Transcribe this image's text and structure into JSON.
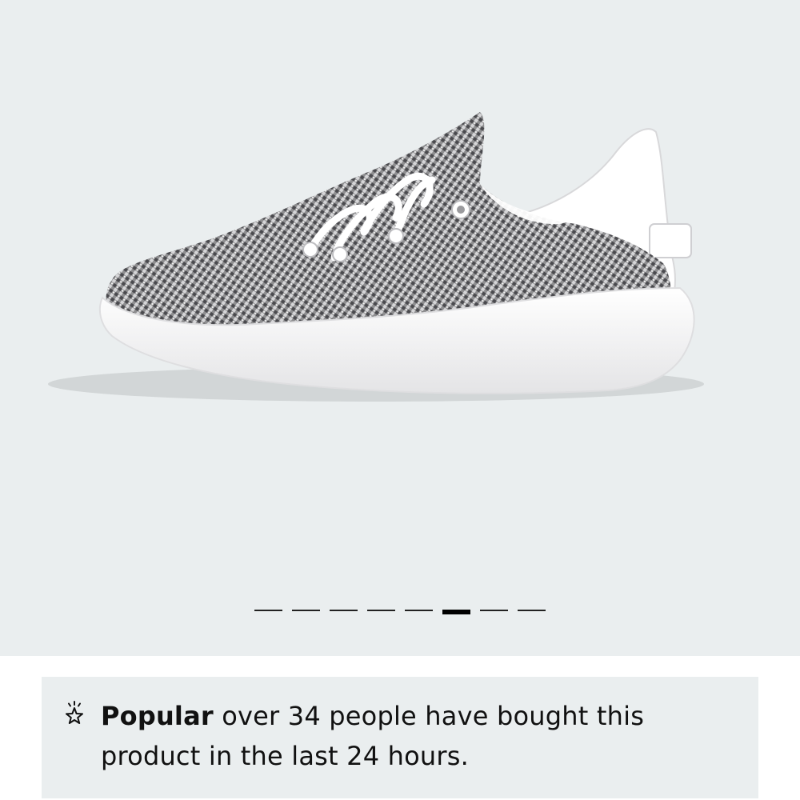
{
  "gallery": {
    "image_alt": "Grey knit sneaker with white laces and white sole, side view",
    "slide_count": 8,
    "active_index": 5
  },
  "popular_banner": {
    "icon": "sparkle-star-icon",
    "highlight": "Popular",
    "message": "over 34 people have bought this product in the last 24 hours."
  },
  "colors": {
    "background": "#eaeeef",
    "text": "#111111",
    "indicator": "#000000"
  }
}
